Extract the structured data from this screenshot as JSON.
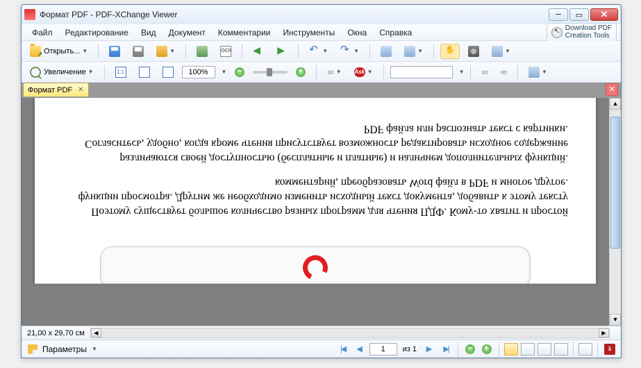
{
  "window": {
    "title": "Формат PDF - PDF-XChange Viewer"
  },
  "menu": {
    "file": "Файл",
    "edit": "Редактирование",
    "view": "Вид",
    "document": "Документ",
    "comments": "Комментарии",
    "tools": "Инструменты",
    "windows": "Окна",
    "help": "Справка"
  },
  "promo": {
    "line1": "Download PDF",
    "line2": "Creation Tools"
  },
  "toolbar": {
    "open": "Открыть...",
    "ocr": "OCR",
    "zoom_label": "Увеличение",
    "fit_actual": "1:1",
    "zoom_value": "100%",
    "ask": "Ask"
  },
  "tab": {
    "name": "Формат PDF"
  },
  "document": {
    "para1": "Поэтому существует большое количество разных программ для чтения ПДФ. Кому-то хватит и простой функции просмотра. Другим же необходимо изменить исходный текст документа, добавить к этому тексту комментарий, преобразовать Word файл в PDF и многое другое.",
    "para2": "различаются своей доступностью (бесплатные и платные) и наличием дополнительных функций. Согласитесь, удобно, когда кроме чтения присутствует возможность редактировать исходное содержание PDF файла или распознать текст с картинки."
  },
  "status": {
    "page_size": "21,00 x 29,70 см",
    "params": "Параметры",
    "page_no": "1",
    "page_total": "из 1"
  }
}
